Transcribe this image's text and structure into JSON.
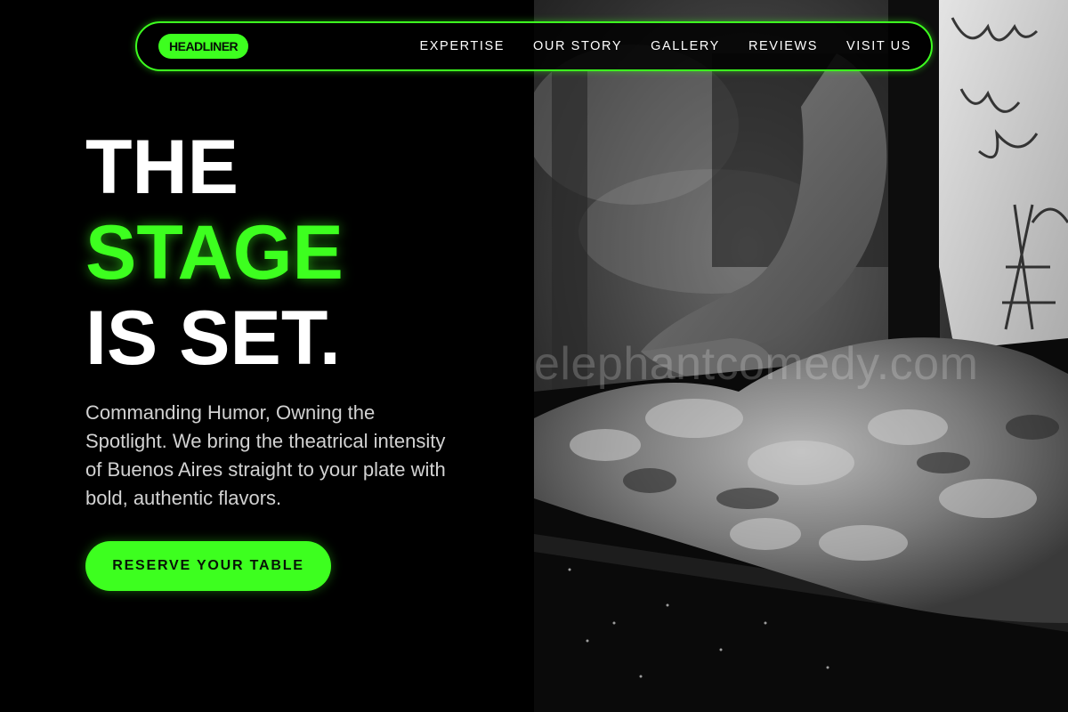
{
  "brand": {
    "logo_label": "HEADLINER",
    "accent_color": "#3dff1f"
  },
  "nav": {
    "items": [
      {
        "label": "EXPERTISE"
      },
      {
        "label": "OUR STORY"
      },
      {
        "label": "GALLERY"
      },
      {
        "label": "REVIEWS"
      },
      {
        "label": "VISIT US"
      }
    ]
  },
  "hero": {
    "headline_line1": "THE",
    "headline_line2": "STAGE",
    "headline_line3": "IS SET.",
    "subtext": "Commanding Humor, Owning the Spotlight. We bring the theatrical intensity of Buenos Aires straight to your plate with bold, authentic flavors.",
    "cta_label": "RESERVE YOUR TABLE"
  },
  "photo": {
    "description_icon": "grill-photo",
    "watermark": "elephantcomedy.com"
  }
}
